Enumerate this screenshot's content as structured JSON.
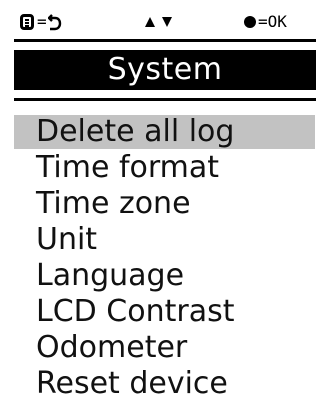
{
  "hints": {
    "menu_back": "=",
    "ok": "=OK"
  },
  "icons": {
    "menu": "menu-list-icon",
    "back": "back-arrow-icon",
    "up": "up-triangle-icon",
    "down": "down-triangle-icon",
    "ok_dot": "filled-circle-icon"
  },
  "title": "System",
  "menu": {
    "selected_index": 0,
    "items": [
      {
        "label": "Delete all log"
      },
      {
        "label": "Time format"
      },
      {
        "label": "Time zone"
      },
      {
        "label": "Unit"
      },
      {
        "label": "Language"
      },
      {
        "label": "LCD Contrast"
      },
      {
        "label": "Odometer"
      },
      {
        "label": "Reset device"
      }
    ]
  },
  "colors": {
    "selection": "#c2c2c2",
    "title_bg": "#000000",
    "title_fg": "#ffffff"
  }
}
